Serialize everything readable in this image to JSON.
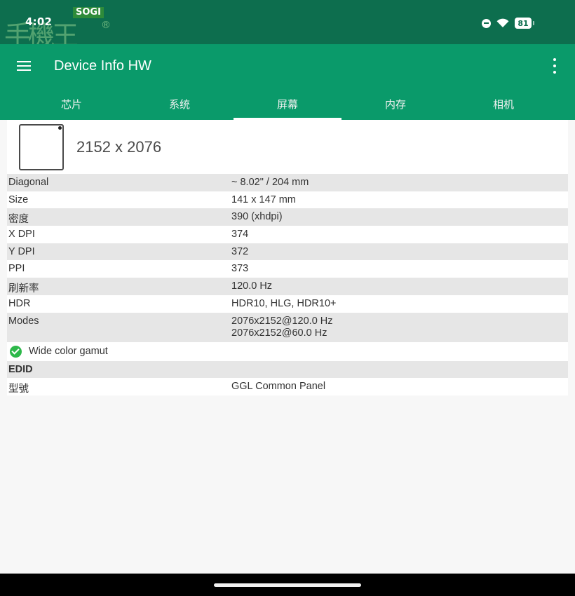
{
  "status_bar": {
    "time": "4:02",
    "battery": "81",
    "icons": [
      "do-not-disturb-icon",
      "wifi-icon",
      "battery-icon"
    ]
  },
  "watermark": {
    "badge": "SOGI",
    "glyphs": "手機王",
    "reg": "®"
  },
  "app_bar": {
    "title": "Device Info HW",
    "menu_icon": "hamburger-menu-icon",
    "more_icon": "more-vert-icon"
  },
  "tabs": [
    {
      "label": "芯片",
      "active": false
    },
    {
      "label": "系统",
      "active": false
    },
    {
      "label": "屏幕",
      "active": true
    },
    {
      "label": "内存",
      "active": false
    },
    {
      "label": "相机",
      "active": false
    }
  ],
  "screen": {
    "resolution": "2152 x 2076",
    "rows": [
      {
        "label": "Diagonal",
        "value": "~ 8.02\" / 204 mm"
      },
      {
        "label": "Size",
        "value": "141 x 147 mm"
      },
      {
        "label": "密度",
        "value": "390 (xhdpi)"
      },
      {
        "label": "X DPI",
        "value": "374"
      },
      {
        "label": "Y DPI",
        "value": "372"
      },
      {
        "label": "PPI",
        "value": "373"
      },
      {
        "label": "刷新率",
        "value": "120.0 Hz"
      },
      {
        "label": "HDR",
        "value": "HDR10, HLG, HDR10+"
      }
    ],
    "modes": {
      "label": "Modes",
      "values": [
        "2076x2152@120.0 Hz",
        "2076x2152@60.0 Hz"
      ]
    },
    "gamut": "Wide color gamut",
    "edid_title": "EDID",
    "edid_rows": [
      {
        "label": "型號",
        "value": "GGL Common Panel"
      }
    ]
  },
  "colors": {
    "status_bar": "#0d6e4e",
    "app_bar": "#0a9a6a",
    "row_shade": "#e6e6e6",
    "check": "#2db84a"
  }
}
